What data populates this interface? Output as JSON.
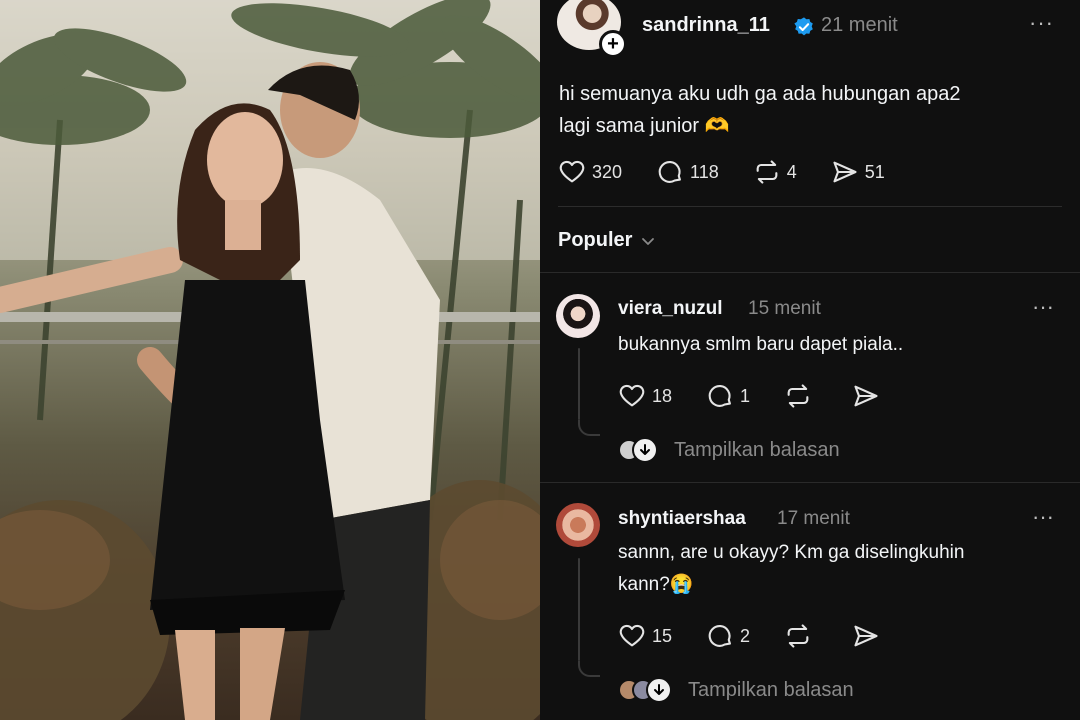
{
  "post": {
    "username": "sandrinna_11",
    "time": "21 menit",
    "more": "···",
    "text_line1": "hi semuanya aku udh ga ada hubungan apa2",
    "text_line2": "lagi sama junior 🫶",
    "likes": "320",
    "comments": "118",
    "reposts": "4",
    "shares": "51"
  },
  "sort": {
    "label": "Populer"
  },
  "comments": [
    {
      "username": "viera_nuzul",
      "time": "15 menit",
      "text_line1": "bukannya smlm baru dapet piala..",
      "likes": "18",
      "replies": "1",
      "show_replies": "Tampilkan balasan"
    },
    {
      "username": "shyntiaershaa",
      "time": "17 menit",
      "text_line1": "sannn, are u okayy? Km ga diselingkuhin",
      "text_line2": "kann?😭",
      "likes": "15",
      "replies": "2",
      "show_replies": "Tampilkan balasan"
    }
  ],
  "colors": {
    "verified": "#1d9bf0",
    "muted": "#8a8a8a",
    "background": "#101010"
  },
  "icons": [
    "heart-icon",
    "comment-icon",
    "repost-icon",
    "share-icon",
    "verified-icon",
    "plus-icon",
    "chevron-down-icon",
    "more-icon"
  ]
}
